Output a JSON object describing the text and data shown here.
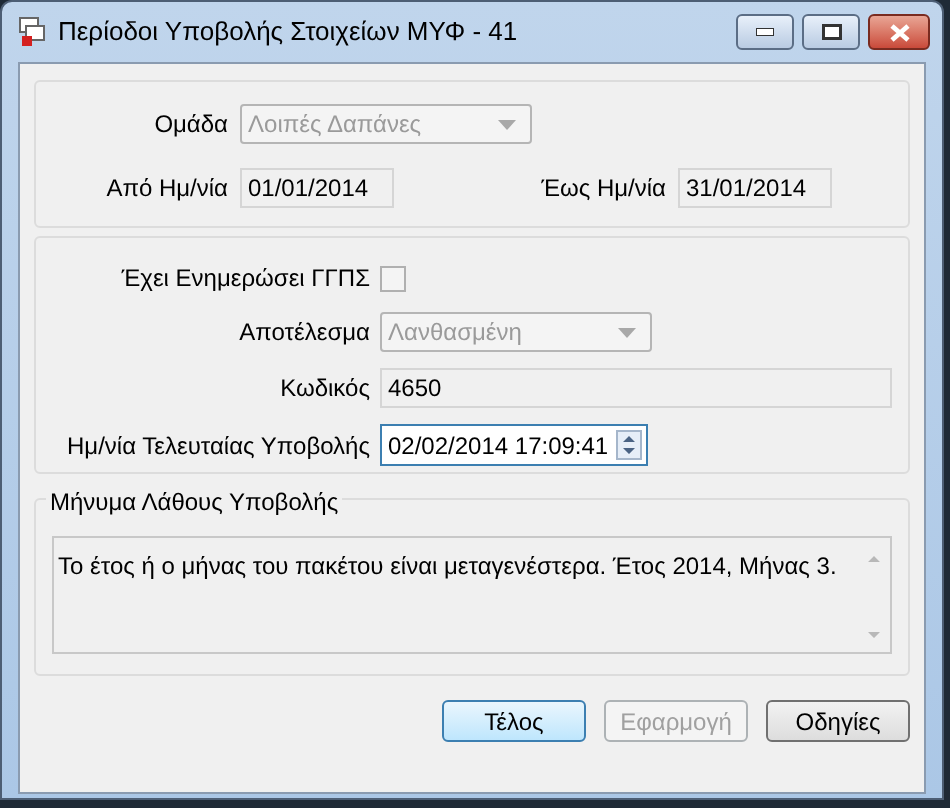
{
  "window": {
    "title": "Περίοδοι Υποβολής Στοιχείων ΜΥΦ - 41"
  },
  "period": {
    "group": {
      "label": "Ομάδα",
      "value": "Λοιπές Δαπάνες",
      "disabled": true
    },
    "from": {
      "label": "Από Ημ/νία",
      "value": "01/01/2014"
    },
    "to": {
      "label": "Έως Ημ/νία",
      "value": "31/01/2014"
    }
  },
  "submission": {
    "updated": {
      "label": "Έχει Ενημερώσει ΓΓΠΣ",
      "checked": false
    },
    "result": {
      "label": "Αποτέλεσμα",
      "value": "Λανθασμένη",
      "disabled": true
    },
    "code": {
      "label": "Κωδικός",
      "value": "4650"
    },
    "last_submission": {
      "label": "Ημ/νία Τελευταίας Υποβολής",
      "value": "02/02/2014 17:09:41"
    }
  },
  "error_message": {
    "legend": "Μήνυμα Λάθους Υποβολής",
    "text": "Το έτος ή ο μήνας του πακέτου είναι μεταγενέστερα. Έτος 2014, Μήνας 3."
  },
  "buttons": [
    {
      "label": "Τέλος",
      "default": true,
      "disabled": false
    },
    {
      "label": "Εφαρμογή",
      "default": false,
      "disabled": true
    },
    {
      "label": "Οδηγίες",
      "default": false,
      "disabled": false
    }
  ]
}
